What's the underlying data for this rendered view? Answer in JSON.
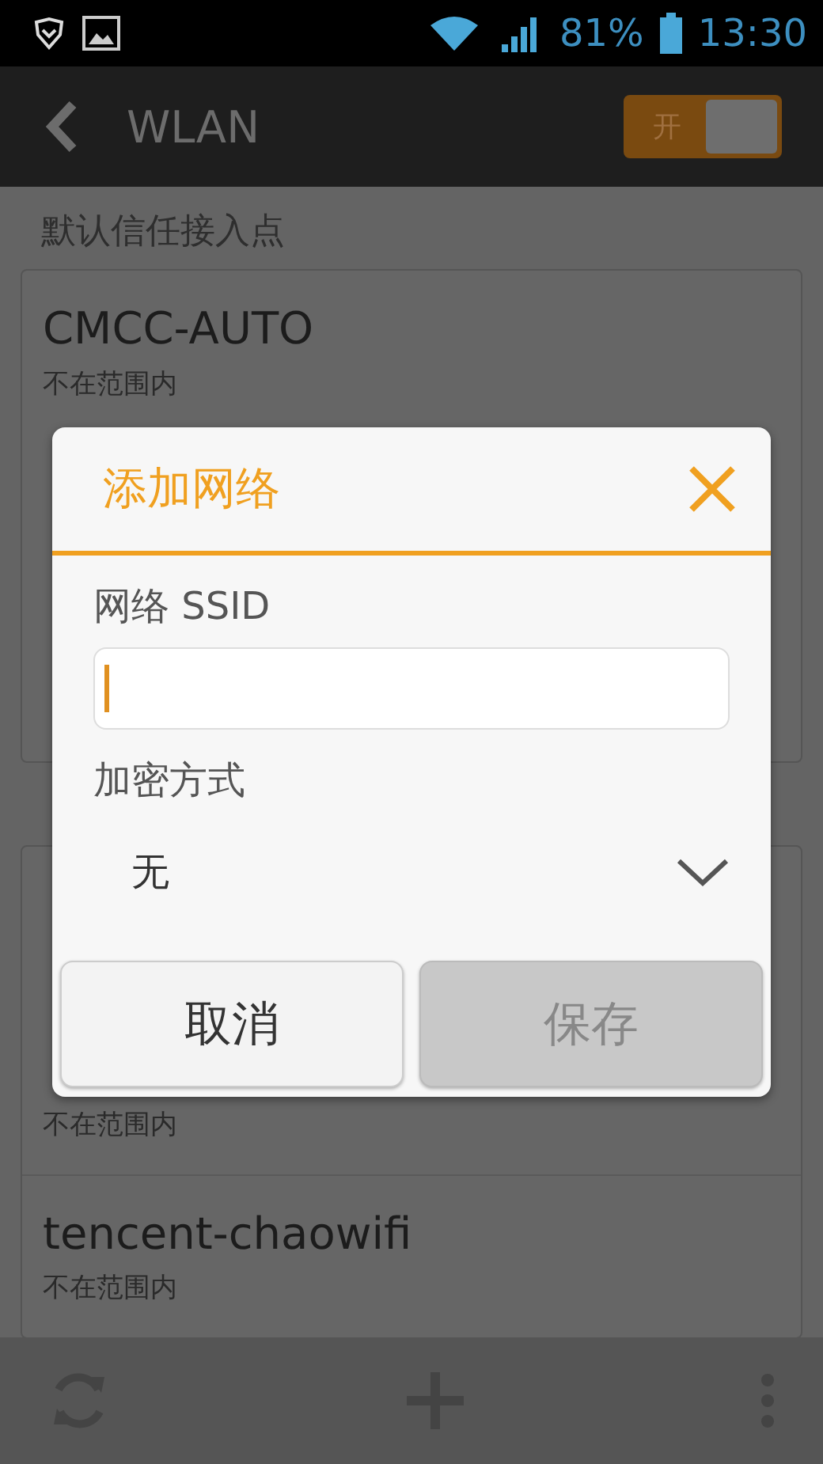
{
  "status_bar": {
    "battery": "81%",
    "time": "13:30"
  },
  "header": {
    "title": "WLAN",
    "toggle": {
      "label": "开",
      "on": true
    }
  },
  "sections": [
    {
      "title": "默认信任接入点",
      "networks": [
        {
          "name": "CMCC-AUTO",
          "status": "不在范围内"
        }
      ]
    },
    {
      "networks": [
        {
          "status": "不在范围内"
        },
        {
          "name": "tencent-chaowifi",
          "status": "不在范围内"
        }
      ]
    }
  ],
  "dialog": {
    "title": "添加网络",
    "ssid_label": "网络 SSID",
    "security_label": "加密方式",
    "security_value": "无",
    "buttons": [
      {
        "label": "取消",
        "disabled": false
      },
      {
        "label": "保存",
        "disabled": true
      }
    ]
  }
}
